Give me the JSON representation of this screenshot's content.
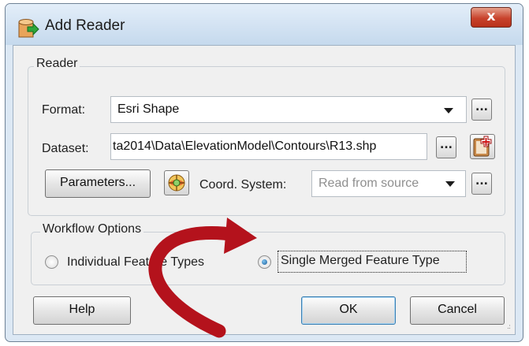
{
  "window": {
    "title": "Add Reader",
    "title_icon": "add-reader-icon",
    "close_label": "x"
  },
  "reader_group": {
    "title": "Reader",
    "format_label": "Format:",
    "format_value": "Esri Shape",
    "dataset_label": "Dataset:",
    "dataset_value": "ta2014\\Data\\ElevationModel\\Contours\\R13.shp",
    "ellipsis_label": "...",
    "parameters_label": "Parameters...",
    "coord_label": "Coord. System:",
    "coord_value": "Read from source"
  },
  "workflow_group": {
    "title": "Workflow Options",
    "options": [
      {
        "label": "Individual Feature Types",
        "selected": false
      },
      {
        "label": "Single Merged Feature Type",
        "selected": true
      }
    ]
  },
  "buttons": {
    "help": "Help",
    "ok": "OK",
    "cancel": "Cancel"
  },
  "annotation": {
    "arrow_color": "#b4121c"
  }
}
